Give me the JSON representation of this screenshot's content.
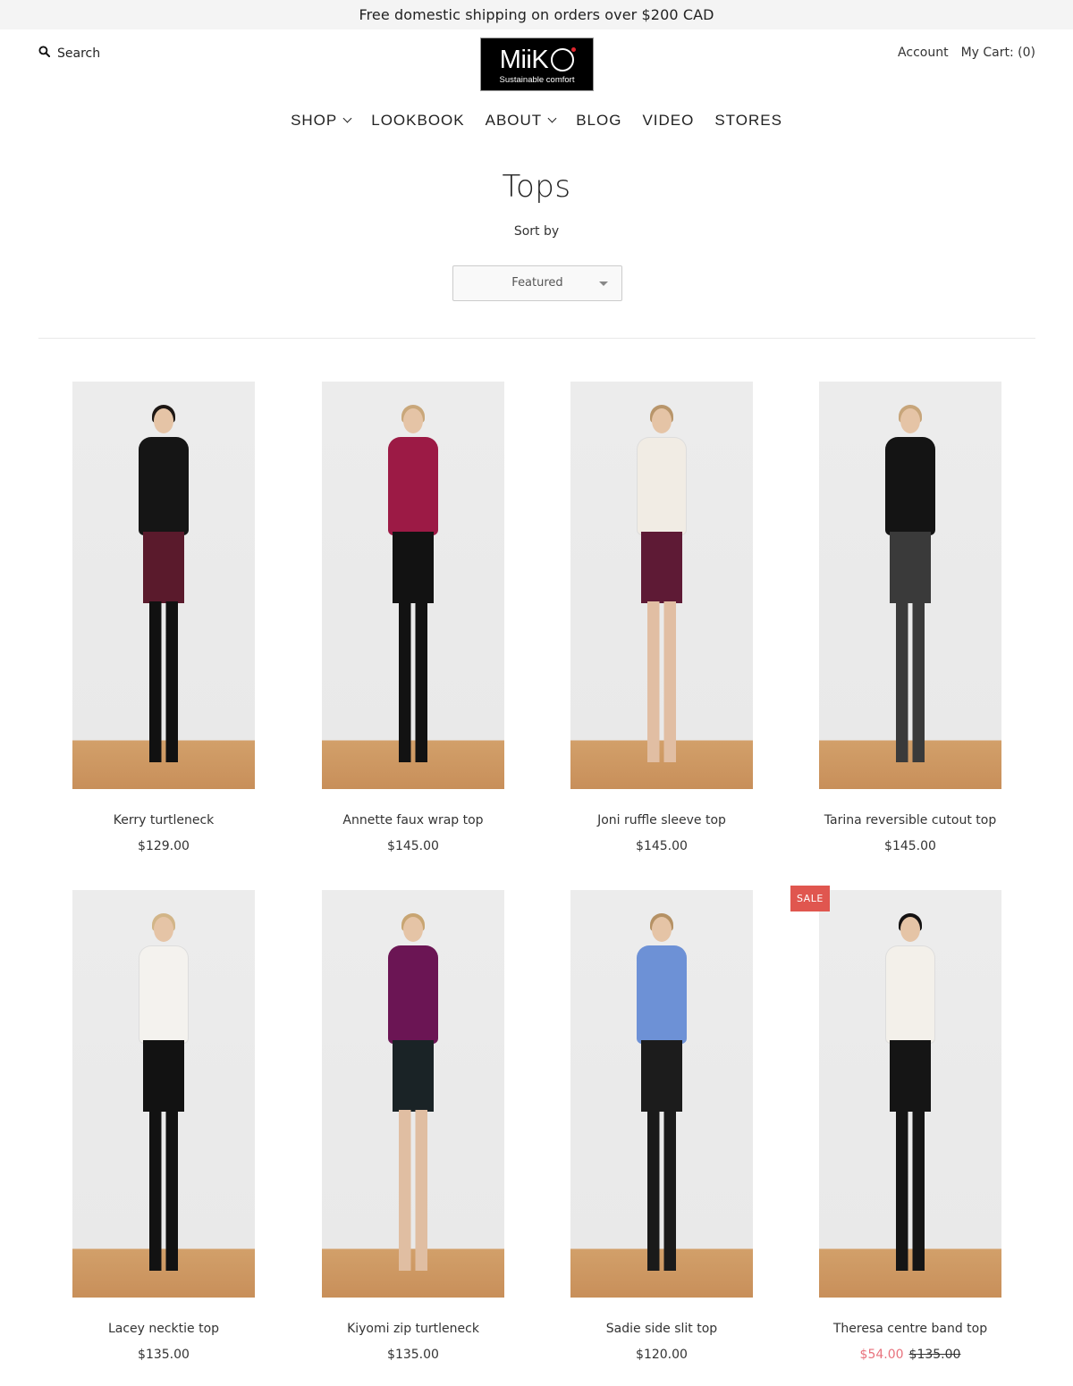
{
  "announcement": "Free domestic shipping on orders over $200 CAD",
  "header": {
    "search_label": "Search",
    "logo_brand": "MiiK",
    "logo_tagline": "Sustainable comfort",
    "account_label": "Account",
    "cart_label": "My Cart: (0)"
  },
  "nav": [
    {
      "label": "SHOP",
      "has_dropdown": true
    },
    {
      "label": "LOOKBOOK",
      "has_dropdown": false
    },
    {
      "label": "ABOUT",
      "has_dropdown": true
    },
    {
      "label": "BLOG",
      "has_dropdown": false
    },
    {
      "label": "VIDEO",
      "has_dropdown": false
    },
    {
      "label": "STORES",
      "has_dropdown": false
    }
  ],
  "collection": {
    "title": "Tops",
    "sort_label": "Sort by",
    "sort_value": "Featured"
  },
  "colors": {
    "sale_badge": "#e0564f",
    "sale_price": "#e8727d"
  },
  "products": [
    {
      "name": "Kerry turtleneck",
      "price": "$129.00",
      "top_color": "#151515",
      "bottom_color": "#5a1a2c",
      "leg_color": "#111111",
      "hair_color": "#1d1714"
    },
    {
      "name": "Annette faux wrap top",
      "price": "$145.00",
      "top_color": "#9c1a45",
      "bottom_color": "#121212",
      "leg_color": "#121212",
      "hair_color": "#c9a77a"
    },
    {
      "name": "Joni ruffle sleeve top",
      "price": "$145.00",
      "top_color": "#f1ece4",
      "bottom_color": "#5e1a35",
      "leg_color": "#e1bea3",
      "hair_color": "#b8956a"
    },
    {
      "name": "Tarina reversible cutout top",
      "price": "$145.00",
      "top_color": "#141414",
      "bottom_color": "#3a3a3a",
      "leg_color": "#3a3a3a",
      "hair_color": "#c7a57a"
    },
    {
      "name": "Lacey necktie top",
      "price": "$135.00",
      "top_color": "#f4f2ee",
      "bottom_color": "#121212",
      "leg_color": "#121212",
      "hair_color": "#d2b588"
    },
    {
      "name": "Kiyomi zip turtleneck",
      "price": "$135.00",
      "top_color": "#6b1554",
      "bottom_color": "#1a2326",
      "leg_color": "#e0bea2",
      "hair_color": "#c8a572"
    },
    {
      "name": "Sadie side slit top",
      "price": "$120.00",
      "top_color": "#6d91d6",
      "bottom_color": "#1c1c1c",
      "leg_color": "#1a1a1a",
      "hair_color": "#b59164"
    },
    {
      "name": "Theresa centre band top",
      "price": "$54.00",
      "compare_price": "$135.00",
      "on_sale": true,
      "badge": "SALE",
      "top_color": "#f3f0ea",
      "bottom_color": "#151515",
      "leg_color": "#151515",
      "hair_color": "#141212"
    }
  ]
}
